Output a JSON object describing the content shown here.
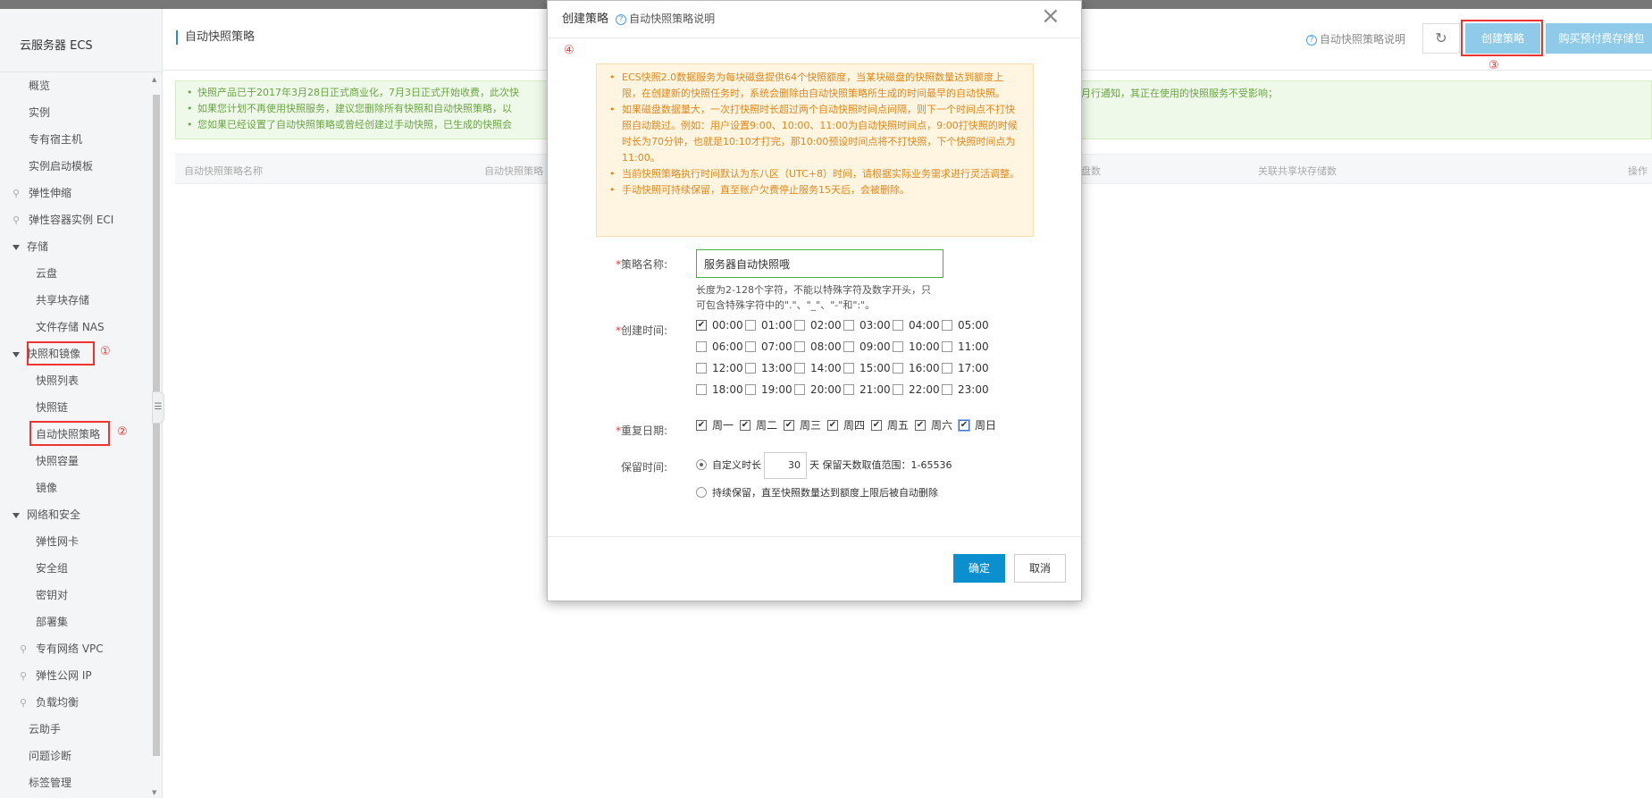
{
  "sidebar": {
    "title": "云服务器 ECS",
    "items": [
      {
        "label": "概览"
      },
      {
        "label": "实例"
      },
      {
        "label": "专有宿主机"
      },
      {
        "label": "实例启动模板"
      },
      {
        "label": "弹性伸缩"
      },
      {
        "label": "弹性容器实例 ECI"
      },
      {
        "label": "存储"
      },
      {
        "label": "云盘"
      },
      {
        "label": "共享块存储"
      },
      {
        "label": "文件存储 NAS"
      },
      {
        "label": "快照和镜像"
      },
      {
        "label": "快照列表"
      },
      {
        "label": "快照链"
      },
      {
        "label": "自动快照策略"
      },
      {
        "label": "快照容量"
      },
      {
        "label": "镜像"
      },
      {
        "label": "网络和安全"
      },
      {
        "label": "弹性网卡"
      },
      {
        "label": "安全组"
      },
      {
        "label": "密钥对"
      },
      {
        "label": "部署集"
      },
      {
        "label": "专有网络 VPC"
      },
      {
        "label": "弹性公网 IP"
      },
      {
        "label": "负载均衡"
      },
      {
        "label": "云助手"
      },
      {
        "label": "问题诊断"
      },
      {
        "label": "标签管理"
      }
    ]
  },
  "annotations": {
    "c1": "①",
    "c2": "②",
    "c3": "③",
    "c4": "④"
  },
  "header": {
    "title": "自动快照策略",
    "help_link": "自动快照策略说明",
    "refresh_icon": "↻",
    "create_button": "创建策略",
    "buy_button": "购买预付费存储包"
  },
  "notice": {
    "line1": "快照产品已于2017年3月28日正式商业化，7月3日正式开始收费，此次快",
    "line1_tail": "月行通知，其正在使用的快照服务不受影响；",
    "line2": "如果您计划不再使用快照服务，建议您删除所有快照和自动快照策略，以",
    "line3": "您如果已经设置了自动快照策略或曾经创建过手动快照，已生成的快照会"
  },
  "table": {
    "headers": [
      "自动快照策略名称",
      "自动快照策略",
      "盘数",
      "关联共享块存储数",
      "操作"
    ]
  },
  "modal": {
    "title": "创建策略",
    "help": "自动快照策略说明",
    "close_icon": "×",
    "warnings": [
      "ECS快照2.0数据服务为每块磁盘提供64个快照额度，当某块磁盘的快照数量达到额度上限，在创建新的快照任务时，系统会删除由自动快照策略所生成的时间最早的自动快照。",
      "如果磁盘数据量大，一次打快照时长超过两个自动快照时间点间隔，则下一个时间点不打快照自动跳过。例如：用户设置9:00、10:00、11:00为自动快照时间点，9:00打快照的时候时长为70分钟，也就是10:10才打完，那10:00预设时间点将不打快照，下个快照时间点为11:00。",
      "当前快照策略执行时间默认为东八区（UTC+8）时间，请根据实际业务需求进行灵活调整。",
      "手动快照可持续保留，直至账户欠费停止服务15天后，会被删除。"
    ],
    "name_label": "策略名称:",
    "name_value": "服务器自动快照哦",
    "name_hint": "长度为2-128个字符，不能以特殊字符及数字开头，只可包含特殊字符中的\".\"、\"_\"、\"-\"和\":\"。",
    "time_label": "创建时间:",
    "times": [
      "00:00",
      "01:00",
      "02:00",
      "03:00",
      "04:00",
      "05:00",
      "06:00",
      "07:00",
      "08:00",
      "09:00",
      "10:00",
      "11:00",
      "12:00",
      "13:00",
      "14:00",
      "15:00",
      "16:00",
      "17:00",
      "18:00",
      "19:00",
      "20:00",
      "21:00",
      "22:00",
      "23:00"
    ],
    "times_checked": [
      "00:00"
    ],
    "repeat_label": "重复日期:",
    "days": [
      "周一",
      "周二",
      "周三",
      "周四",
      "周五",
      "周六",
      "周日"
    ],
    "retention_label": "保留时间:",
    "custom_label": "自定义时长",
    "days_value": "30",
    "days_unit": "天",
    "range_text": "保留天数取值范围：1-65536",
    "persist_label": "持续保留，直至快照数量达到额度上限后被自动删除",
    "ok_button": "确定",
    "cancel_button": "取消",
    "check_mark": "✔"
  },
  "colors": {
    "primary": "#0c8fcf",
    "create_button": "#8fcbe9",
    "notice_text": "#6aa544",
    "warning_text": "#e3861b",
    "highlight": "#ee3333"
  }
}
